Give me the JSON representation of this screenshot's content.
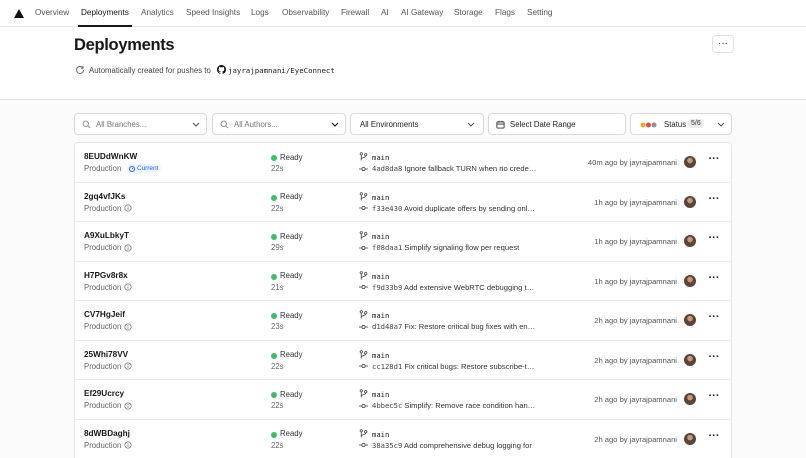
{
  "nav": {
    "tabs": [
      {
        "label": "Overview"
      },
      {
        "label": "Deployments",
        "active": true
      },
      {
        "label": "Analytics"
      },
      {
        "label": "Speed Insights"
      },
      {
        "label": "Logs"
      },
      {
        "label": "Observability"
      },
      {
        "label": "Firewall"
      },
      {
        "label": "AI"
      },
      {
        "label": "AI Gateway"
      },
      {
        "label": "Storage"
      },
      {
        "label": "Flags"
      },
      {
        "label": "Setting"
      }
    ]
  },
  "header": {
    "title": "Deployments",
    "subtext": "Automatically created for pushes to",
    "repo": "jayrajpamnani/EyeConnect",
    "more_label": "···"
  },
  "filters": {
    "branches_placeholder": "All Branches...",
    "authors_placeholder": "All Authors...",
    "environment": "All Environments",
    "date_range": "Select Date Range",
    "status_label": "Status",
    "status_count": "5/6"
  },
  "colors": {
    "ready": "#37c267",
    "current": "#2563eb",
    "status_dots": [
      "#f5a524",
      "#e5484d",
      "#8f8f8f"
    ]
  },
  "deployments": [
    {
      "id": "8EUDdWnKW",
      "env": "Production",
      "current_badge": "Current",
      "status": "Ready",
      "duration": "22s",
      "branch": "main",
      "hash": "4ad8da8",
      "message": "Ignore fallback TURN when no credentials",
      "meta": "40m ago by jayrajpamnani"
    },
    {
      "id": "2gq4vfJKs",
      "env": "Production",
      "status": "Ready",
      "duration": "22s",
      "branch": "main",
      "hash": "f33e430",
      "message": "Avoid duplicate offers by sending only once",
      "meta": "1h ago by jayrajpamnani"
    },
    {
      "id": "A9XuLbkyT",
      "env": "Production",
      "status": "Ready",
      "duration": "29s",
      "branch": "main",
      "hash": "f08daa1",
      "message": "Simplify signaling flow per request",
      "meta": "1h ago by jayrajpamnani"
    },
    {
      "id": "H7PGv8r8x",
      "env": "Production",
      "status": "Ready",
      "duration": "21s",
      "branch": "main",
      "hash": "f9d33b9",
      "message": "Add extensive WebRTC debugging tools",
      "meta": "1h ago by jayrajpamnani"
    },
    {
      "id": "CV7HgJeif",
      "env": "Production",
      "status": "Ready",
      "duration": "23s",
      "branch": "main",
      "hash": "d1d48a7",
      "message": "Fix: Restore critical bug fixes with enhanced",
      "meta": "2h ago by jayrajpamnani"
    },
    {
      "id": "25Whi78VV",
      "env": "Production",
      "status": "Ready",
      "duration": "22s",
      "branch": "main",
      "hash": "cc128d1",
      "message": "Fix critical bugs: Restore subscribe-to-events",
      "meta": "2h ago by jayrajpamnani"
    },
    {
      "id": "Ef29Ucrcy",
      "env": "Production",
      "status": "Ready",
      "duration": "22s",
      "branch": "main",
      "hash": "4bbec5c",
      "message": "Simplify: Remove race condition handling",
      "meta": "2h ago by jayrajpamnani"
    },
    {
      "id": "8dWBDaghj",
      "env": "Production",
      "status": "Ready",
      "duration": "22s",
      "branch": "main",
      "hash": "38a35c9",
      "message": "Add comprehensive debug logging for",
      "meta": "2h ago by jayrajpamnani"
    }
  ]
}
